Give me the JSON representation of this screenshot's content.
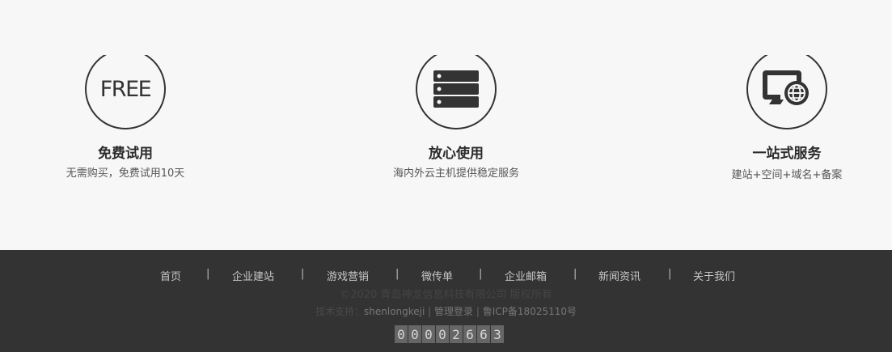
{
  "features": [
    {
      "icon": "free-text-icon",
      "icon_text": "FREE",
      "title": "免费试用",
      "desc": "无需购买，免费试用10天"
    },
    {
      "icon": "server-icon",
      "title": "放心使用",
      "desc": "海内外云主机提供稳定服务"
    },
    {
      "icon": "monitor-globe-icon",
      "title": "一站式服务",
      "desc": "建站+空间+域名+备案"
    }
  ],
  "footer": {
    "nav": [
      "首页",
      "企业建站",
      "游戏营销",
      "微传单",
      "企业邮箱",
      "新闻资讯",
      "关于我们"
    ],
    "separator": "|",
    "copyright": "©2020 青岛神龙信息科技有限公司 版权所有",
    "support_prefix": "技术支持：",
    "support_name": "shenlongkeji",
    "admin_login": "管理登录",
    "icp": "鲁ICP备18025110号",
    "counter_digits": [
      "0",
      "0",
      "0",
      "0",
      "2",
      "6",
      "6",
      "3"
    ]
  },
  "colors": {
    "footer_bg": "#333333",
    "page_bg": "#f7f7f7",
    "counter_bg": "#666666"
  }
}
